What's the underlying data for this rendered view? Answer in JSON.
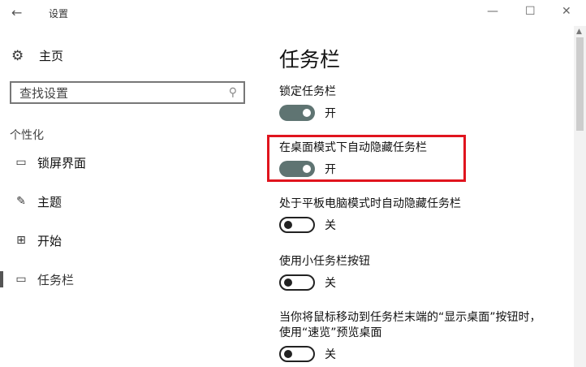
{
  "window": {
    "title": "设置",
    "back_glyph": "←",
    "minimize_glyph": "—",
    "maximize_glyph": "☐",
    "close_glyph": "✕"
  },
  "sidebar": {
    "home": {
      "icon": "gear-icon",
      "glyph": "⚙",
      "label": "主页"
    },
    "search": {
      "placeholder": "查找设置",
      "icon": "search-icon",
      "glyph": "⚲"
    },
    "section_label": "个性化",
    "items": [
      {
        "icon": "lock-screen-icon",
        "glyph": "▭",
        "label": "锁屏界面"
      },
      {
        "icon": "theme-icon",
        "glyph": "✎",
        "label": "主题"
      },
      {
        "icon": "start-icon",
        "glyph": "⊞",
        "label": "开始"
      },
      {
        "icon": "taskbar-icon",
        "glyph": "▭",
        "label": "任务栏",
        "active": true
      }
    ]
  },
  "main": {
    "title": "任务栏",
    "settings": [
      {
        "label": "锁定任务栏",
        "state": "开",
        "on": true
      },
      {
        "label": "在桌面模式下自动隐藏任务栏",
        "state": "开",
        "on": true,
        "highlighted": true
      },
      {
        "label": "处于平板电脑模式时自动隐藏任务栏",
        "state": "关",
        "on": false
      },
      {
        "label": "使用小任务栏按钮",
        "state": "关",
        "on": false
      },
      {
        "label": "当你将鼠标移动到任务栏末端的“显示桌面”按钮时，",
        "label_line2": "使用“速览”预览桌面",
        "state": "关",
        "on": false
      }
    ]
  },
  "colors": {
    "toggle_on": "#5f7472",
    "highlight_border": "#e0141e"
  }
}
